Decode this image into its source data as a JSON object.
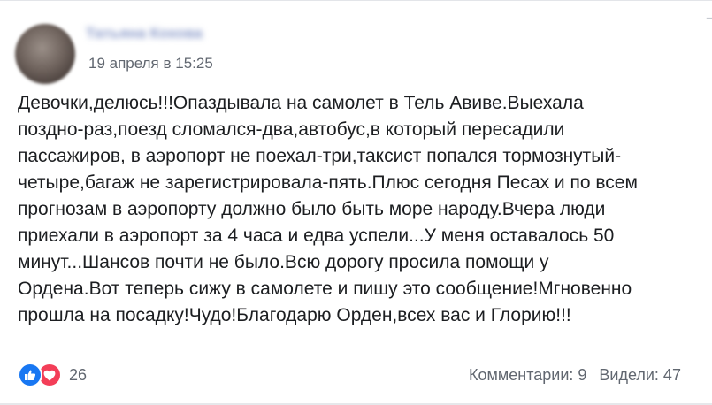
{
  "post": {
    "author_name": "Татьяна Кохова",
    "timestamp": "19 апреля в 15:25",
    "text": "Девочки,делюсь!!!Опаздывала на самолет в Тель Авиве.Выехала\nпоздно-раз,поезд сломался-два,автобус,в который пересадили\nпассажиров, в аэропорт не поехал-три,таксист попался тормознутый-\nчетыре,багаж не зарегистрировала-пять.Плюс сегодня Песах и по всем\nпрогнозам в аэропорту должно было быть море народу.Вчера люди\nприехали в аэропорт за 4 часа и едва успели...У меня оставалось 50\nминут...Шансов почти не было.Всю дорогу просила помощи у\nОрдена.Вот теперь сижу в самолете и пишу это сообщение!Мгновенно\nпрошла на посадку!Чудо!Благодарю Орден,всех вас и Глорию!!!"
  },
  "reactions": {
    "icons": [
      "like-icon",
      "love-icon"
    ],
    "colors": {
      "like": "#1877f2",
      "love": "#f33e58"
    },
    "count": "26"
  },
  "stats": {
    "comments": "Комментарии: 9",
    "views": "Видели: 47"
  },
  "colors": {
    "text": "#1c1e21",
    "meta": "#616770",
    "author_blurred": "#8a9ac9"
  }
}
